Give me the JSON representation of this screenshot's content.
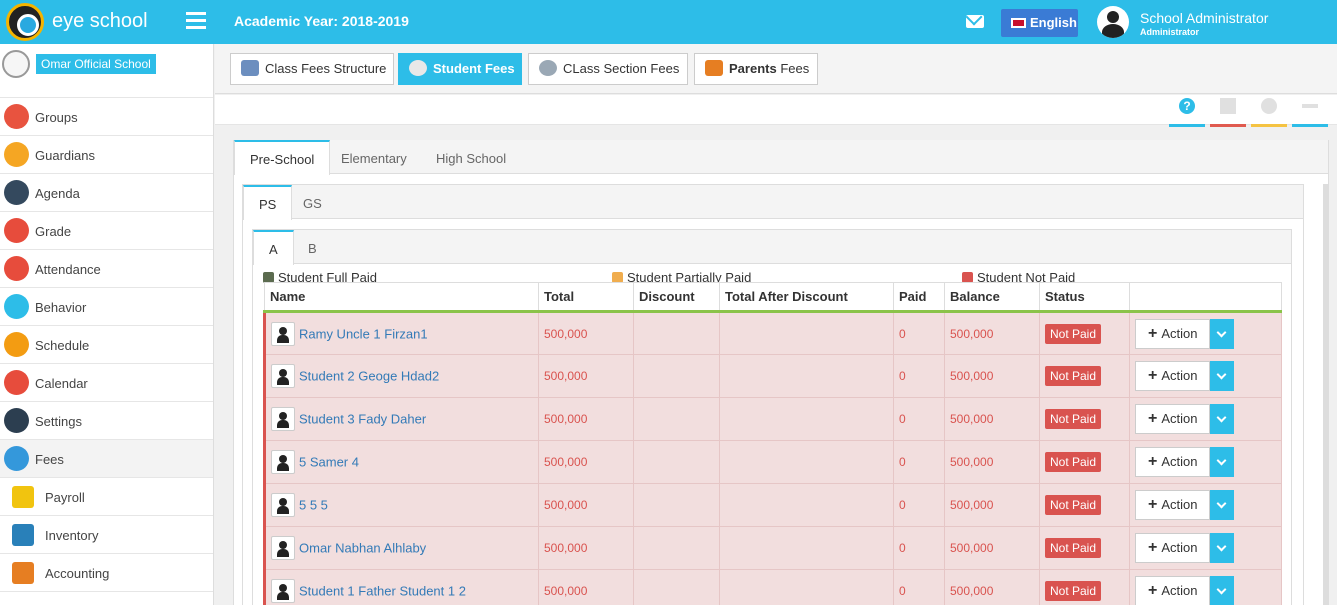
{
  "header": {
    "brand": "eye school",
    "academic_year": "Academic Year: 2018-2019",
    "language": "English",
    "user_name": "School Administrator",
    "user_role": "Administrator"
  },
  "sidebar": {
    "school_name": "Omar Official School",
    "items": [
      {
        "label": "Groups",
        "icon": "groups-icon",
        "color": "#e8533f"
      },
      {
        "label": "Guardians",
        "icon": "guardians-icon",
        "color": "#f5a623"
      },
      {
        "label": "Agenda",
        "icon": "agenda-icon",
        "color": "#34495e"
      },
      {
        "label": "Grade",
        "icon": "grade-icon",
        "color": "#e74c3c"
      },
      {
        "label": "Attendance",
        "icon": "attendance-icon",
        "color": "#e74c3c"
      },
      {
        "label": "Behavior",
        "icon": "behavior-icon",
        "color": "#2dbde8"
      },
      {
        "label": "Schedule",
        "icon": "schedule-icon",
        "color": "#f39c12"
      },
      {
        "label": "Calendar",
        "icon": "calendar-icon",
        "color": "#e74c3c"
      },
      {
        "label": "Settings",
        "icon": "settings-icon",
        "color": "#2c3e50"
      },
      {
        "label": "Fees",
        "icon": "fees-icon",
        "color": "#3498db"
      },
      {
        "label": "Payroll",
        "icon": "payroll-icon",
        "color": "#f1c40f"
      },
      {
        "label": "Inventory",
        "icon": "inventory-icon",
        "color": "#2980b9"
      },
      {
        "label": "Accounting",
        "icon": "accounting-icon",
        "color": "#e67e22"
      }
    ]
  },
  "toolbar": {
    "buttons": [
      {
        "label": "Class Fees Structure",
        "icon": "glasses-icon"
      },
      {
        "label": "Student Fees",
        "icon": "student-icon"
      },
      {
        "label": "CLass Section Fees",
        "icon": "class-section-icon"
      },
      {
        "label_bold": "Parents",
        "label": " Fees",
        "icon": "parents-icon"
      }
    ]
  },
  "controls": {
    "help": "?"
  },
  "tabs_level1": [
    "Pre-School",
    "Elementary",
    "High School"
  ],
  "tabs_level2": [
    "PS",
    "GS"
  ],
  "tabs_level3": [
    "A",
    "B"
  ],
  "legend": {
    "full": "Student Full Paid",
    "partial": "Student Partially Paid",
    "not_paid": "Student Not Paid",
    "colors": {
      "full": "#5b6b4f",
      "partial": "#f0ad4e",
      "not_paid": "#d9534f"
    }
  },
  "table": {
    "columns": [
      "Name",
      "Total",
      "Discount",
      "Total After Discount",
      "Paid",
      "Balance",
      "Status",
      ""
    ],
    "action_label": "Action",
    "rows": [
      {
        "name": "Ramy Uncle 1 Firzan1",
        "total": "500,000",
        "discount": "",
        "after": "",
        "paid": "0",
        "balance": "500,000",
        "status": "Not Paid"
      },
      {
        "name": "Student 2 Geoge Hdad2",
        "total": "500,000",
        "discount": "",
        "after": "",
        "paid": "0",
        "balance": "500,000",
        "status": "Not Paid"
      },
      {
        "name": "Student 3 Fady Daher",
        "total": "500,000",
        "discount": "",
        "after": "",
        "paid": "0",
        "balance": "500,000",
        "status": "Not Paid"
      },
      {
        "name": "5 Samer 4",
        "total": "500,000",
        "discount": "",
        "after": "",
        "paid": "0",
        "balance": "500,000",
        "status": "Not Paid"
      },
      {
        "name": "5 5 5",
        "total": "500,000",
        "discount": "",
        "after": "",
        "paid": "0",
        "balance": "500,000",
        "status": "Not Paid"
      },
      {
        "name": "Omar Nabhan Alhlaby",
        "total": "500,000",
        "discount": "",
        "after": "",
        "paid": "0",
        "balance": "500,000",
        "status": "Not Paid"
      },
      {
        "name": "Student 1 Father Student 1 2",
        "total": "500,000",
        "discount": "",
        "after": "",
        "paid": "0",
        "balance": "500,000",
        "status": "Not Paid"
      }
    ]
  }
}
